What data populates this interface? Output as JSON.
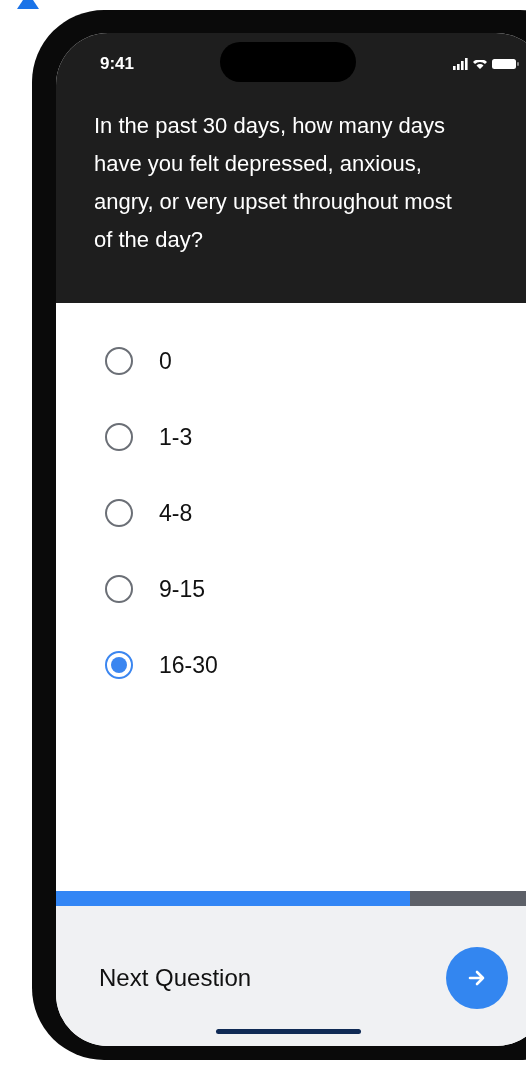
{
  "status_bar": {
    "time": "9:41"
  },
  "question": "In the past 30 days, how many days have you felt depressed, anxious, angry, or very upset throughout most of the day?",
  "options": [
    {
      "label": "0",
      "selected": false
    },
    {
      "label": "1-3",
      "selected": false
    },
    {
      "label": "4-8",
      "selected": false
    },
    {
      "label": "9-15",
      "selected": false
    },
    {
      "label": "16-30",
      "selected": true
    }
  ],
  "progress": {
    "level": 0.72
  },
  "footer": {
    "label": "Next Question"
  }
}
